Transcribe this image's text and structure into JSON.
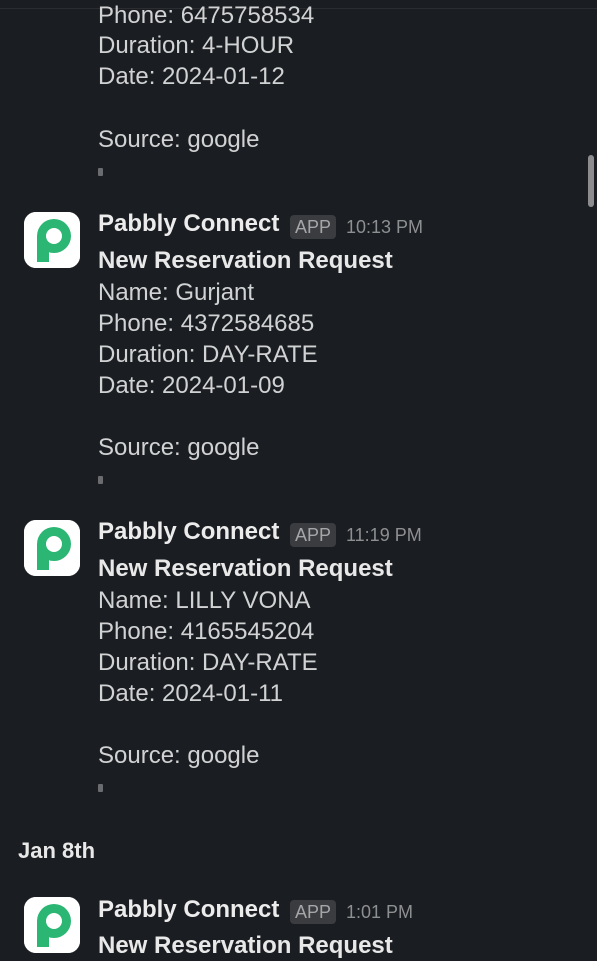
{
  "top_partial_message": {
    "phone": "Phone: 6475758534",
    "duration": "Duration: 4-HOUR",
    "date": "Date: 2024-01-12",
    "source": "Source: google"
  },
  "messages": [
    {
      "sender": "Pabbly Connect",
      "badge": "APP",
      "time": "10:13 PM",
      "title": "New Reservation Request",
      "name": "Name: Gurjant",
      "phone": "Phone: 4372584685",
      "duration": "Duration: DAY-RATE",
      "date": "Date: 2024-01-09",
      "source": "Source: google"
    },
    {
      "sender": "Pabbly Connect",
      "badge": "APP",
      "time": "11:19 PM",
      "title": "New Reservation Request",
      "name": "Name: LILLY VONA",
      "phone": "Phone: 4165545204",
      "duration": "Duration: DAY-RATE",
      "date": "Date: 2024-01-11",
      "source": "Source: google"
    }
  ],
  "date_separator": "Jan 8th",
  "last_message": {
    "sender": "Pabbly Connect",
    "badge": "APP",
    "time": "1:01 PM",
    "title": "New Reservation Request"
  },
  "colors": {
    "background": "#1a1d21",
    "text": "#d1d2d3",
    "avatar_green": "#2bb673"
  },
  "icons": {
    "avatar": "pabbly-logo-icon"
  }
}
